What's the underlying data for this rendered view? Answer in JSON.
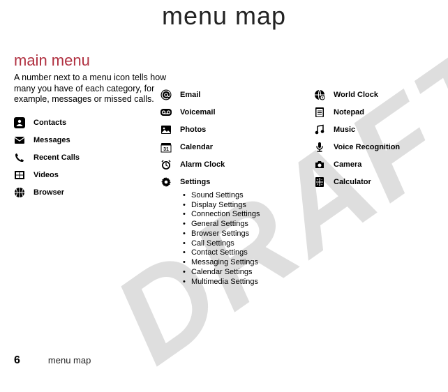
{
  "title": "menu map",
  "subtitle": "main menu",
  "intro": "A number next to a menu icon tells how many you have of each category, for example, messages or missed calls.",
  "watermark": "DRAFT",
  "col1": [
    {
      "icon": "contacts",
      "label": "Contacts"
    },
    {
      "icon": "messages",
      "label": "Messages"
    },
    {
      "icon": "recent-calls",
      "label": "Recent Calls"
    },
    {
      "icon": "videos",
      "label": "Videos"
    },
    {
      "icon": "browser",
      "label": "Browser"
    }
  ],
  "col2": [
    {
      "icon": "email",
      "label": "Email"
    },
    {
      "icon": "voicemail",
      "label": "Voicemail"
    },
    {
      "icon": "photos",
      "label": "Photos"
    },
    {
      "icon": "calendar",
      "label": "Calendar"
    },
    {
      "icon": "alarm",
      "label": "Alarm Clock"
    },
    {
      "icon": "settings",
      "label": "Settings"
    }
  ],
  "settings_sub": [
    "Sound Settings",
    "Display Settings",
    "Connection Settings",
    "General Settings",
    "Browser Settings",
    "Call Settings",
    "Contact Settings",
    "Messaging Settings",
    "Calendar Settings",
    "Multimedia Settings"
  ],
  "col3": [
    {
      "icon": "world-clock",
      "label": "World Clock"
    },
    {
      "icon": "notepad",
      "label": "Notepad"
    },
    {
      "icon": "music",
      "label": "Music"
    },
    {
      "icon": "voice-rec",
      "label": "Voice Recognition"
    },
    {
      "icon": "camera",
      "label": "Camera"
    },
    {
      "icon": "calculator",
      "label": "Calculator"
    }
  ],
  "footer": {
    "page_num": "6",
    "text": "menu map"
  }
}
